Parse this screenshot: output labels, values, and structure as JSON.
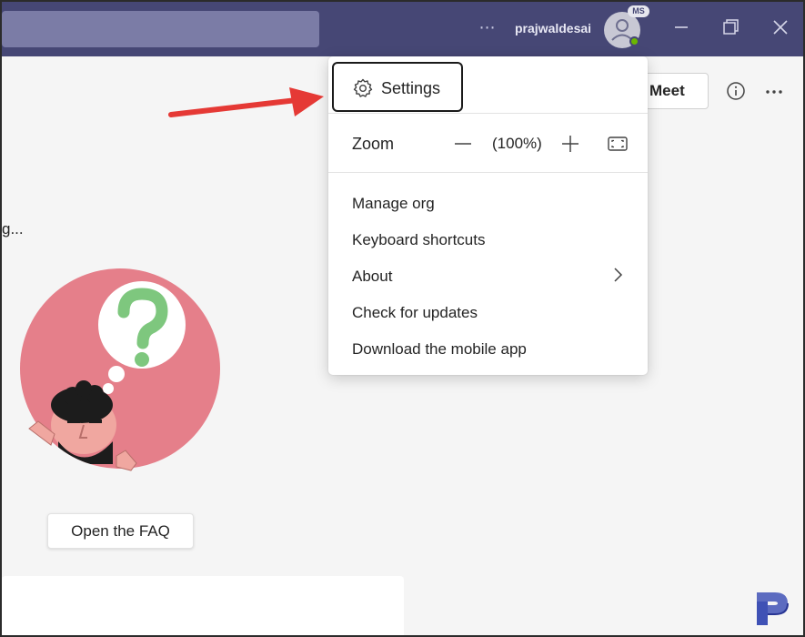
{
  "titlebar": {
    "username": "prajwaldesai",
    "avatar_badge": "MS",
    "more_icon": "ellipsis-icon",
    "window_controls": [
      "minimize-icon",
      "restore-icon",
      "close-icon"
    ]
  },
  "main": {
    "meet_label": "Meet",
    "loading_text": "g...",
    "faq_button": "Open the FAQ"
  },
  "menu": {
    "settings_label": "Settings",
    "zoom_label": "Zoom",
    "zoom_value": "(100%)",
    "items": [
      {
        "label": "Manage org"
      },
      {
        "label": "Keyboard shortcuts"
      },
      {
        "label": "About",
        "has_submenu": true
      },
      {
        "label": "Check for updates"
      },
      {
        "label": "Download the mobile app"
      }
    ]
  },
  "colors": {
    "titlebar": "#464775",
    "search_box": "#7b7ca6",
    "annotation_arrow": "#e53935",
    "illustration_circle": "#e57f8a",
    "question_mark": "#7ec77e",
    "brand_logo": "#3f51b5"
  }
}
